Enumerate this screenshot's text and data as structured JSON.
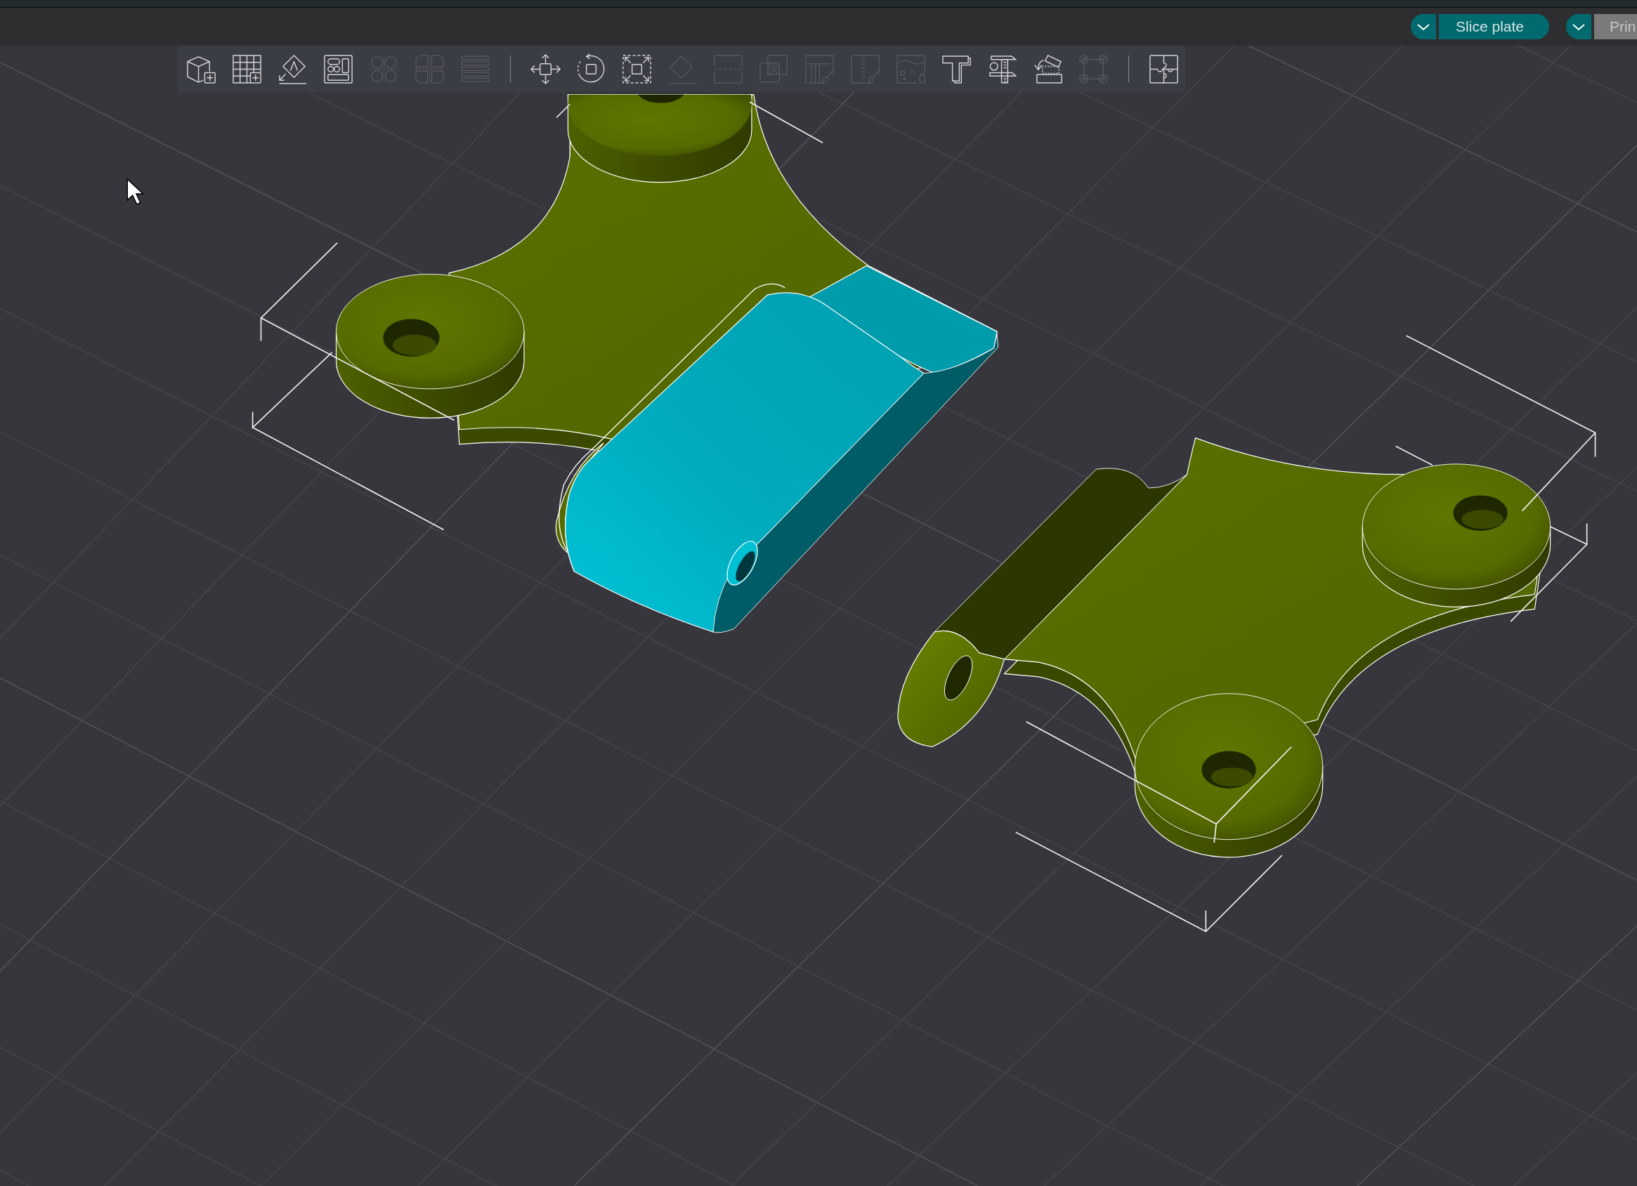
{
  "top_bar": {
    "actions": [
      {
        "label": "Slice plate",
        "disabled": false
      },
      {
        "label": "Prin",
        "disabled": true
      }
    ]
  },
  "toolbar": {
    "groups": [
      [
        {
          "disabled": false
        },
        {
          "disabled": false
        },
        {
          "disabled": false
        },
        {
          "disabled": false
        },
        {
          "disabled": true
        },
        {
          "disabled": true
        },
        {
          "disabled": true
        }
      ],
      [
        {
          "disabled": false
        },
        {
          "disabled": false
        },
        {
          "disabled": false
        },
        {
          "disabled": true
        },
        {
          "disabled": true
        },
        {
          "disabled": true
        },
        {
          "disabled": true
        },
        {
          "disabled": true
        },
        {
          "disabled": true
        },
        {
          "disabled": false
        },
        {
          "disabled": false
        },
        {
          "disabled": false
        },
        {
          "disabled": true
        }
      ],
      [
        {
          "disabled": false
        }
      ]
    ]
  }
}
